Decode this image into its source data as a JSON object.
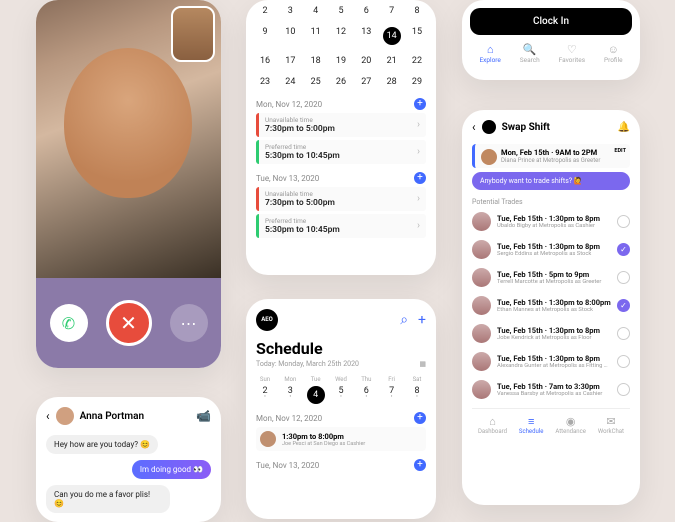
{
  "call": {
    "pip_name": "Self preview"
  },
  "calendar": {
    "weeks": [
      [
        "2",
        "3",
        "4",
        "5",
        "6",
        "7",
        "8"
      ],
      [
        "9",
        "10",
        "11",
        "12",
        "13",
        "14",
        "15"
      ],
      [
        "16",
        "17",
        "18",
        "19",
        "20",
        "21",
        "22"
      ],
      [
        "23",
        "24",
        "25",
        "26",
        "27",
        "28",
        "29"
      ]
    ],
    "selected": "14",
    "days": [
      {
        "label": "Mon, Nov 12, 2020",
        "slots": [
          {
            "type": "red",
            "title": "Unavailable time",
            "time": "7:30pm to 5:00pm"
          },
          {
            "type": "grn",
            "title": "Preferred time",
            "time": "5:30pm to 10:45pm"
          }
        ]
      },
      {
        "label": "Tue, Nov 13, 2020",
        "slots": [
          {
            "type": "red",
            "title": "Unavailable time",
            "time": "7:30pm to 5:00pm"
          },
          {
            "type": "grn",
            "title": "Preferred time",
            "time": "5:30pm to 10:45pm"
          }
        ]
      }
    ]
  },
  "clock": {
    "button": "Clock In",
    "tabs": [
      {
        "icon": "⌂",
        "label": "Explore"
      },
      {
        "icon": "🔍",
        "label": "Search"
      },
      {
        "icon": "♡",
        "label": "Favorites"
      },
      {
        "icon": "☺",
        "label": "Profile"
      }
    ]
  },
  "swap": {
    "title": "Swap Shift",
    "mine": {
      "time": "Mon, Feb 15th · 9AM to 2PM",
      "who": "Diana Prince at Metropolis as Greeter",
      "edit": "EDIT"
    },
    "bubble": "Anybody want to trade shifts? 🙋",
    "potential_label": "Potential Trades",
    "trades": [
      {
        "time": "Tue, Feb 15th · 1:30pm to 8pm",
        "who": "Ubaldo Bigby at Metropolis as Cashier",
        "status": "open"
      },
      {
        "time": "Tue, Feb 15th · 1:30pm to 8pm",
        "who": "Sergio Eddins at Metropolis as Stock",
        "status": "ok"
      },
      {
        "time": "Tue, Feb 15th · 5pm to 9pm",
        "who": "Terrell Marcotte at Metropolis as Greeter",
        "status": "open"
      },
      {
        "time": "Tue, Feb 15th · 1:30pm to 8:00pm",
        "who": "Ethan Mannes at Metropolis as Stock",
        "status": "ok"
      },
      {
        "time": "Tue, Feb 15th · 1:30pm to 8pm",
        "who": "Jobe Kendrick at Metropolis as Floor",
        "status": "open"
      },
      {
        "time": "Tue, Feb 15th · 1:30pm to 8pm",
        "who": "Alexandra Gunter at Metropolis as Fitting Rooms",
        "status": "open"
      },
      {
        "time": "Tue, Feb 15th · 7am to 3:30pm",
        "who": "Vanessa Barsby at Metropolis as Cashier",
        "status": "open"
      }
    ],
    "nav": [
      {
        "icon": "⌂",
        "label": "Dashboard"
      },
      {
        "icon": "≡",
        "label": "Schedule"
      },
      {
        "icon": "◉",
        "label": "Attendance"
      },
      {
        "icon": "✉",
        "label": "WorkChat"
      }
    ]
  },
  "chat": {
    "name": "Anna Portman",
    "msgs": [
      {
        "dir": "in",
        "text": "Hey how are you today? 😊"
      },
      {
        "dir": "out",
        "text": "Im doing good 👀"
      },
      {
        "dir": "in",
        "text": "Can you do me a favor plis! 😊"
      }
    ]
  },
  "schedule": {
    "brand": "AEO",
    "title": "Schedule",
    "today": "Today: Monday, March 25th 2020",
    "dow": [
      "Sun",
      "Mon",
      "Tue",
      "Wed",
      "Thu",
      "Fri",
      "Sat"
    ],
    "nums": [
      "2",
      "3",
      "4",
      "5",
      "6",
      "7",
      "8"
    ],
    "selected": "4",
    "days": [
      {
        "label": "Mon, Nov 12, 2020",
        "time": "1:30pm to 8:00pm",
        "who": "Joe Pesci at San Diego as Cashier"
      },
      {
        "label": "Tue, Nov 13, 2020",
        "time": "",
        "who": ""
      }
    ]
  }
}
